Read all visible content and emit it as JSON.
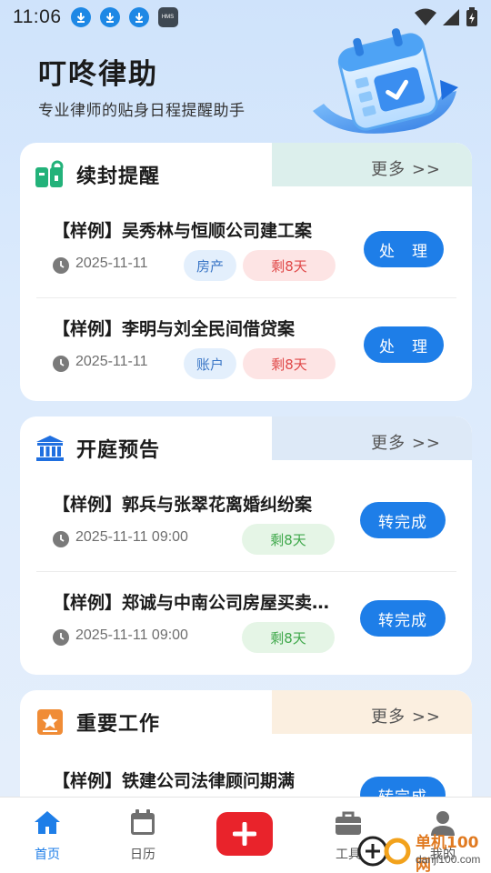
{
  "status_bar": {
    "time": "11:06",
    "notification_icons": [
      "download-icon",
      "download-icon",
      "download-icon",
      "hms-icon"
    ],
    "hms_label": "HMS"
  },
  "header": {
    "title": "叮咚律助",
    "subtitle": "专业律师的贴身日程提醒助手"
  },
  "sections": {
    "renewal": {
      "title": "续封提醒",
      "more": "更多 >>",
      "accent": "#dcefec",
      "items": [
        {
          "title": "【样例】吴秀林与恒顺公司建工案",
          "date": "2025-11-11",
          "tag": "房产",
          "remain": "剩8天",
          "action": "处　理"
        },
        {
          "title": "【样例】李明与刘全民间借贷案",
          "date": "2025-11-11",
          "tag": "账户",
          "remain": "剩8天",
          "action": "处　理"
        }
      ]
    },
    "hearing": {
      "title": "开庭预告",
      "more": "更多 >>",
      "accent": "#dde9f7",
      "items": [
        {
          "title": "【样例】郭兵与张翠花离婚纠纷案",
          "date": "2025-11-11 09:00",
          "remain": "剩8天",
          "action": "转完成"
        },
        {
          "title": "【样例】郑诚与中南公司房屋买卖…",
          "date": "2025-11-11 09:00",
          "remain": "剩8天",
          "action": "转完成"
        }
      ]
    },
    "important": {
      "title": "重要工作",
      "more": "更多 >>",
      "accent": "#fbefe0",
      "items": [
        {
          "title": "【样例】铁建公司法律顾问期满",
          "action": "转完成"
        }
      ]
    }
  },
  "bottom_nav": {
    "home": "首页",
    "calendar": "日历",
    "tools": "工具",
    "mine": "我的"
  },
  "watermark": {
    "line1": "单机100网",
    "line2": "danji100.com"
  },
  "colors": {
    "primary": "#1e7ee8",
    "danger": "#e9232b",
    "success": "#3fa84b"
  }
}
